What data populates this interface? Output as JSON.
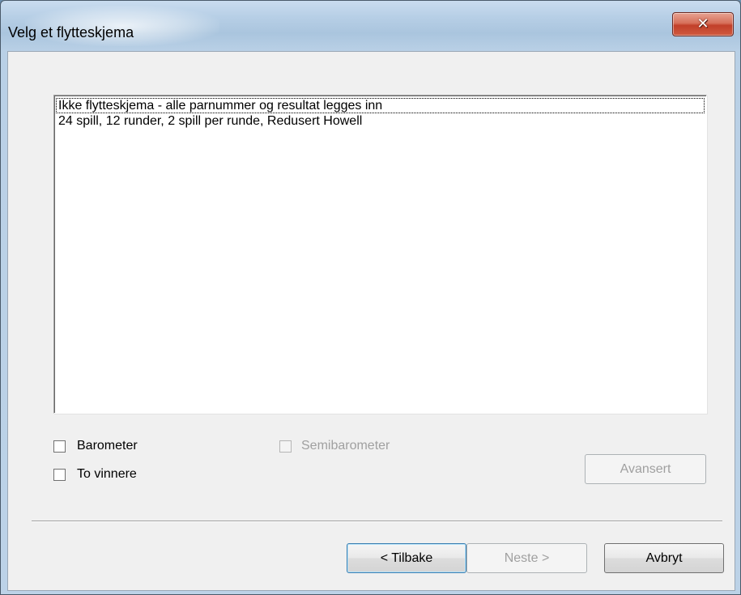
{
  "window": {
    "title": "Velg et flytteskjema",
    "close_icon": "close-icon"
  },
  "schedule_list": {
    "items": [
      "Ikke flytteskjema - alle parnummer og resultat legges inn",
      "24 spill, 12 runder, 2 spill per runde, Redusert Howell"
    ],
    "focused_index": 0
  },
  "options": {
    "barometer_label": "Barometer",
    "barometer_checked": false,
    "semibarometer_label": "Semibarometer",
    "semibarometer_checked": false,
    "semibarometer_enabled": false,
    "to_vinnere_label": "To vinnere",
    "to_vinnere_checked": false
  },
  "buttons": {
    "avansert_label": "Avansert",
    "tilbake_label": "< Tilbake",
    "neste_label": "Neste >",
    "avbryt_label": "Avbryt"
  }
}
